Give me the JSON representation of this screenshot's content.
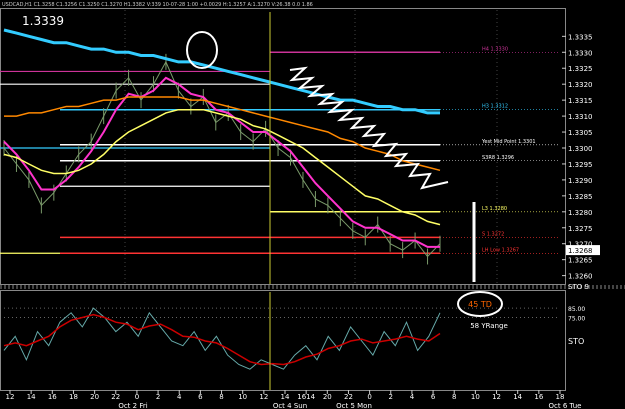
{
  "header": {
    "info_line": "USDCAD,H1 C1.3258 C1.3256 C1.3250 C1.3270 H1.3382 V:339 10-07-28 1:00 +0.0029 H:1.3257 A:1.3270 V:26.38 0.0 1.86",
    "price_tag": "1.3339"
  },
  "colors": {
    "background": "#000000",
    "price": "#7a9a6a",
    "ema_fast": "#ff33cc",
    "ema_mid": "#ffff66",
    "ema_slow": "#ff8800",
    "ema_long": "#33ccff",
    "sto_main": "#66aaaa",
    "sto_signal": "#cc0000",
    "h4_line": "#cc3399",
    "h3_line": "#33ccff",
    "yest_mid": "#ffffff",
    "s3_line": "#ffffff",
    "l3_line": "#ffff66",
    "lh_line": "#ff3333"
  },
  "levels": [
    {
      "label": "H4 1.3330",
      "price": 1.333,
      "color": "#cc3399"
    },
    {
      "label": "H3 1.3312",
      "price": 1.3312,
      "color": "#33ccff"
    },
    {
      "label": "Yest Mid Point 1.3301",
      "price": 1.3301,
      "color": "#ffffff"
    },
    {
      "label": "S3R8 1.3296",
      "price": 1.3296,
      "color": "#ffffff"
    },
    {
      "label": "L3 1.3280",
      "price": 1.328,
      "color": "#ffff66"
    },
    {
      "label": "S 1.3272",
      "price": 1.3272,
      "color": "#ff3333"
    },
    {
      "label": "LH Low 1.3267",
      "price": 1.3267,
      "color": "#ff3333"
    }
  ],
  "annotations": {
    "td_label": "45 TD",
    "range_label": "58 YRange",
    "sto_label": "STO",
    "sto_axis_label": "STO 9"
  },
  "chart_data": {
    "type": "line",
    "ylim": [
      1.3258,
      1.3342
    ],
    "y_ticks": [
      "1.3335",
      "1.3330",
      "1.3325",
      "1.3320",
      "1.3315",
      "1.3310",
      "1.3305",
      "1.3300",
      "1.3295",
      "1.3290",
      "1.3285",
      "1.3280",
      "1.3275",
      "1.3270",
      "1.3265",
      "1.3260"
    ],
    "current_price": "1.3268",
    "x_ticks": [
      "12",
      "14",
      "16",
      "18",
      "20",
      "22",
      "0",
      "2",
      "4",
      "6",
      "8",
      "10",
      "12",
      "14",
      "1614",
      "20",
      "22",
      "0",
      "2",
      "4",
      "6",
      "8",
      "10",
      "12",
      "14",
      "16",
      "18"
    ],
    "day_labels": [
      "Oct 2 Fri",
      "Oct 4 Sun",
      "Oct 5 Mon",
      "Oct 6 Tue"
    ],
    "series": [
      {
        "name": "price",
        "values": [
          1.33,
          1.3295,
          1.329,
          1.3282,
          1.3286,
          1.3292,
          1.3298,
          1.3302,
          1.331,
          1.3318,
          1.3322,
          1.3315,
          1.332,
          1.3327,
          1.3318,
          1.3313,
          1.3316,
          1.3308,
          1.3311,
          1.3305,
          1.3302,
          1.3306,
          1.33,
          1.3297,
          1.329,
          1.3284,
          1.3282,
          1.3278,
          1.3274,
          1.3272,
          1.3276,
          1.327,
          1.3268,
          1.3271,
          1.3266,
          1.327
        ]
      },
      {
        "name": "ema_fast",
        "values": [
          1.3302,
          1.3298,
          1.3293,
          1.3287,
          1.3287,
          1.329,
          1.3294,
          1.3299,
          1.3305,
          1.3312,
          1.3317,
          1.3316,
          1.3318,
          1.3322,
          1.332,
          1.3317,
          1.3316,
          1.3312,
          1.3311,
          1.3308,
          1.3305,
          1.3305,
          1.3302,
          1.3299,
          1.3294,
          1.3289,
          1.3285,
          1.3281,
          1.3277,
          1.3275,
          1.3275,
          1.3273,
          1.3271,
          1.3271,
          1.3269,
          1.3269
        ]
      },
      {
        "name": "ema_mid",
        "values": [
          1.3298,
          1.3297,
          1.3295,
          1.3293,
          1.3292,
          1.3292,
          1.3293,
          1.3295,
          1.3298,
          1.3302,
          1.3305,
          1.3307,
          1.3309,
          1.3311,
          1.3312,
          1.3312,
          1.3312,
          1.3311,
          1.331,
          1.3309,
          1.3307,
          1.3306,
          1.3304,
          1.3302,
          1.33,
          1.3297,
          1.3294,
          1.3291,
          1.3288,
          1.3285,
          1.3284,
          1.3282,
          1.328,
          1.3279,
          1.3277,
          1.3276
        ]
      },
      {
        "name": "ema_slow",
        "values": [
          1.331,
          1.331,
          1.3311,
          1.3311,
          1.3312,
          1.3313,
          1.3313,
          1.3314,
          1.3315,
          1.3315,
          1.3316,
          1.3316,
          1.3316,
          1.3316,
          1.3316,
          1.3315,
          1.3315,
          1.3314,
          1.3313,
          1.3312,
          1.3311,
          1.331,
          1.3309,
          1.3308,
          1.3307,
          1.3306,
          1.3305,
          1.3303,
          1.3302,
          1.33,
          1.3299,
          1.3298,
          1.3296,
          1.3295,
          1.3294,
          1.3293
        ]
      },
      {
        "name": "ema_long",
        "values": [
          1.3337,
          1.3336,
          1.3335,
          1.3334,
          1.3333,
          1.3333,
          1.3332,
          1.3331,
          1.3331,
          1.333,
          1.333,
          1.3329,
          1.3329,
          1.3328,
          1.3327,
          1.3327,
          1.3326,
          1.3325,
          1.3324,
          1.3323,
          1.3322,
          1.3321,
          1.332,
          1.3319,
          1.3318,
          1.3317,
          1.3316,
          1.3315,
          1.3315,
          1.3314,
          1.3313,
          1.3313,
          1.3312,
          1.3312,
          1.3311,
          1.3311
        ]
      }
    ],
    "stochastic": {
      "ylim": [
        0,
        100
      ],
      "ticks": [
        "85.00",
        "75.00"
      ],
      "main": [
        40,
        55,
        30,
        60,
        45,
        70,
        80,
        65,
        85,
        75,
        60,
        70,
        55,
        80,
        65,
        50,
        45,
        60,
        40,
        55,
        35,
        25,
        20,
        30,
        25,
        20,
        35,
        45,
        30,
        55,
        40,
        65,
        50,
        35,
        60,
        45,
        70,
        40,
        55,
        80
      ],
      "signal": [
        45,
        48,
        45,
        50,
        55,
        65,
        72,
        75,
        78,
        75,
        70,
        68,
        62,
        66,
        68,
        62,
        55,
        54,
        50,
        48,
        42,
        35,
        28,
        25,
        26,
        25,
        28,
        33,
        36,
        42,
        45,
        50,
        52,
        48,
        50,
        52,
        55,
        52,
        50,
        58
      ]
    }
  }
}
